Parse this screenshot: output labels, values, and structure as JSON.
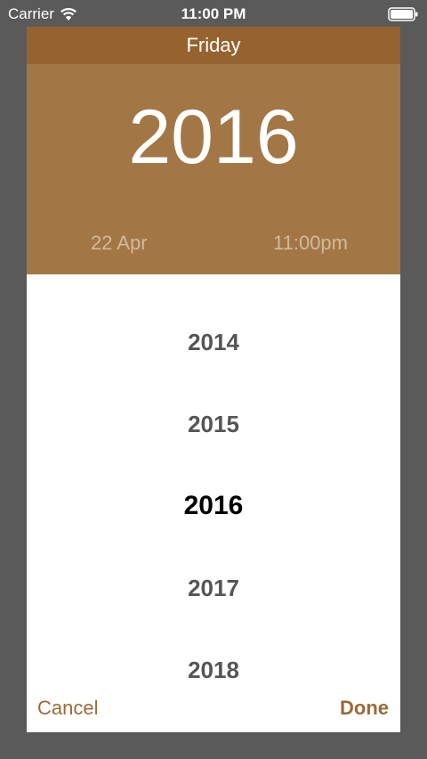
{
  "status_bar": {
    "carrier": "Carrier",
    "time": "11:00 PM"
  },
  "header": {
    "day": "Friday"
  },
  "selection": {
    "year": "2016",
    "date": "22 Apr",
    "time": "11:00pm"
  },
  "years": [
    "2014",
    "2015",
    "2016",
    "2017",
    "2018"
  ],
  "actions": {
    "cancel_label": "Cancel",
    "done_label": "Done"
  },
  "colors": {
    "header_bg": "#96632f",
    "panel_bg": "#a37646",
    "accent": "#9b6a36",
    "backdrop": "#5a5a5a"
  }
}
